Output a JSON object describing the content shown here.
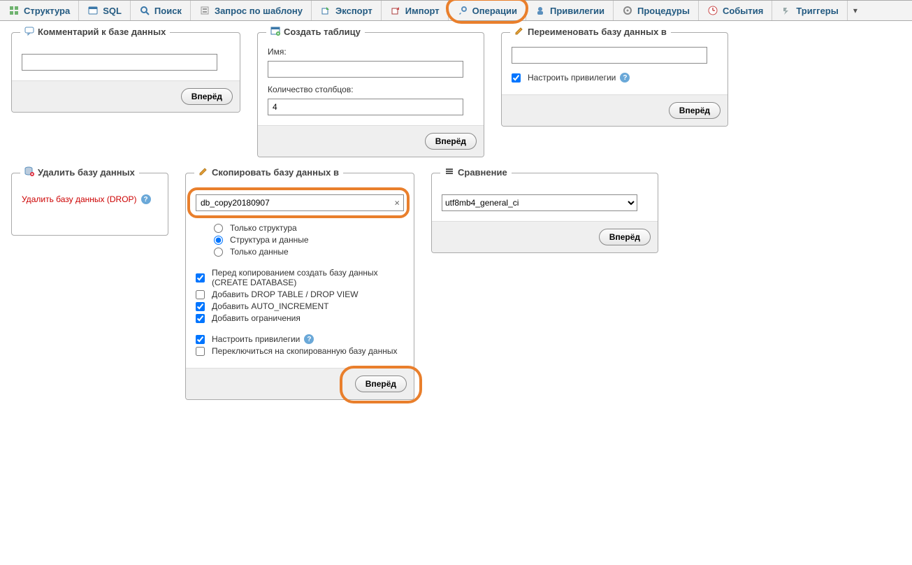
{
  "tabs": {
    "structure": "Структура",
    "sql": "SQL",
    "search": "Поиск",
    "query": "Запрос по шаблону",
    "export": "Экспорт",
    "import": "Импорт",
    "operations": "Операции",
    "privileges": "Привилегии",
    "routines": "Процедуры",
    "events": "События",
    "triggers": "Триггеры"
  },
  "buttons": {
    "go": "Вперёд"
  },
  "comment_panel": {
    "title": "Комментарий к базе данных",
    "value": ""
  },
  "create_table_panel": {
    "title": "Создать таблицу",
    "name_label": "Имя:",
    "name_value": "",
    "cols_label": "Количество столбцов:",
    "cols_value": "4"
  },
  "rename_panel": {
    "title": "Переименовать базу данных в",
    "value": "",
    "adjust_priv_label": "Настроить привилегии",
    "adjust_priv_checked": true
  },
  "drop_panel": {
    "title": "Удалить базу данных",
    "link": "Удалить базу данных (DROP)"
  },
  "copy_panel": {
    "title": "Скопировать базу данных в",
    "dbname": "db_copy20180907",
    "opt_structure_only": "Только структура",
    "opt_structure_and_data": "Структура и данные",
    "opt_data_only": "Только данные",
    "opt_selected": "structure_and_data",
    "cb_create_db": "Перед копированием создать базу данных (CREATE DATABASE)",
    "cb_create_db_checked": true,
    "cb_add_drop": "Добавить DROP TABLE / DROP VIEW",
    "cb_add_drop_checked": false,
    "cb_autoinc": "Добавить AUTO_INCREMENT",
    "cb_autoinc_checked": true,
    "cb_constraints": "Добавить ограничения",
    "cb_constraints_checked": true,
    "cb_adjust_priv": "Настроить привилегии",
    "cb_adjust_priv_checked": true,
    "cb_switch": "Переключиться на скопированную базу данных",
    "cb_switch_checked": false
  },
  "collation_panel": {
    "title": "Сравнение",
    "value": "utf8mb4_general_ci"
  }
}
